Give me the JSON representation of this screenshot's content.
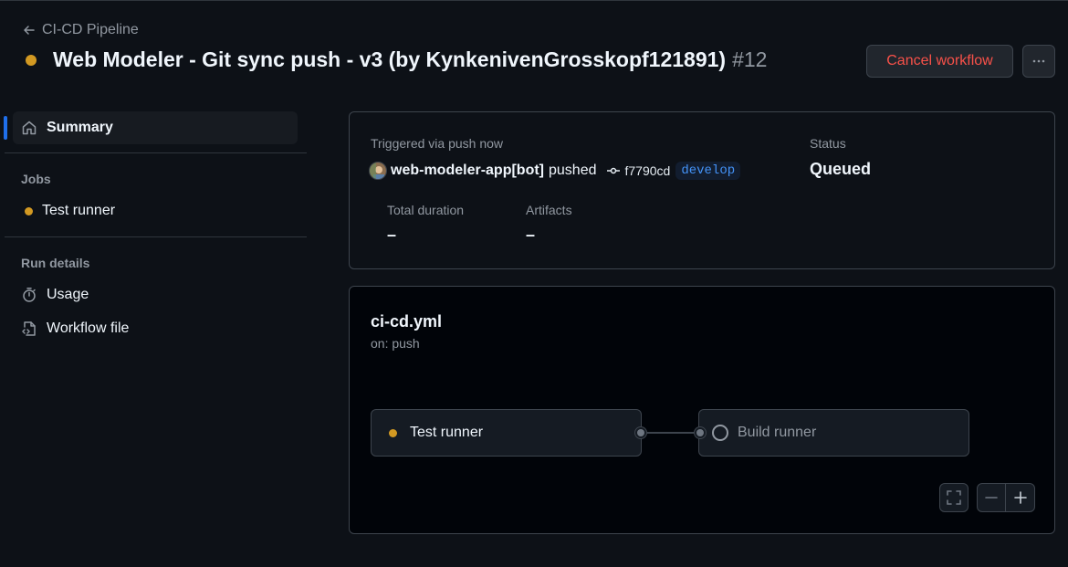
{
  "header": {
    "back_label": "CI-CD Pipeline",
    "title": "Web Modeler - Git sync push - v3 (by KynkenivenGrosskopf121891)",
    "run_number": "#12",
    "cancel_label": "Cancel workflow"
  },
  "sidebar": {
    "summary_label": "Summary",
    "jobs_heading": "Jobs",
    "jobs": [
      {
        "label": "Test runner"
      }
    ],
    "run_details_heading": "Run details",
    "run_details": [
      {
        "label": "Usage"
      },
      {
        "label": "Workflow file"
      }
    ]
  },
  "summary": {
    "trigger_text": "Triggered via push now",
    "actor": "web-modeler-app[bot]",
    "action": "pushed",
    "commit": "f7790cd",
    "branch": "develop",
    "status_label": "Status",
    "status_value": "Queued",
    "duration_label": "Total duration",
    "duration_value": "–",
    "artifacts_label": "Artifacts",
    "artifacts_value": "–"
  },
  "graph": {
    "workflow_file": "ci-cd.yml",
    "trigger": "on: push",
    "nodes": [
      {
        "label": "Test runner",
        "status": "queued"
      },
      {
        "label": "Build runner",
        "status": "pending"
      }
    ]
  },
  "colors": {
    "accent": "#1f6feb",
    "queued": "#d29922",
    "danger": "#f85149",
    "branch": "#4493f8"
  }
}
